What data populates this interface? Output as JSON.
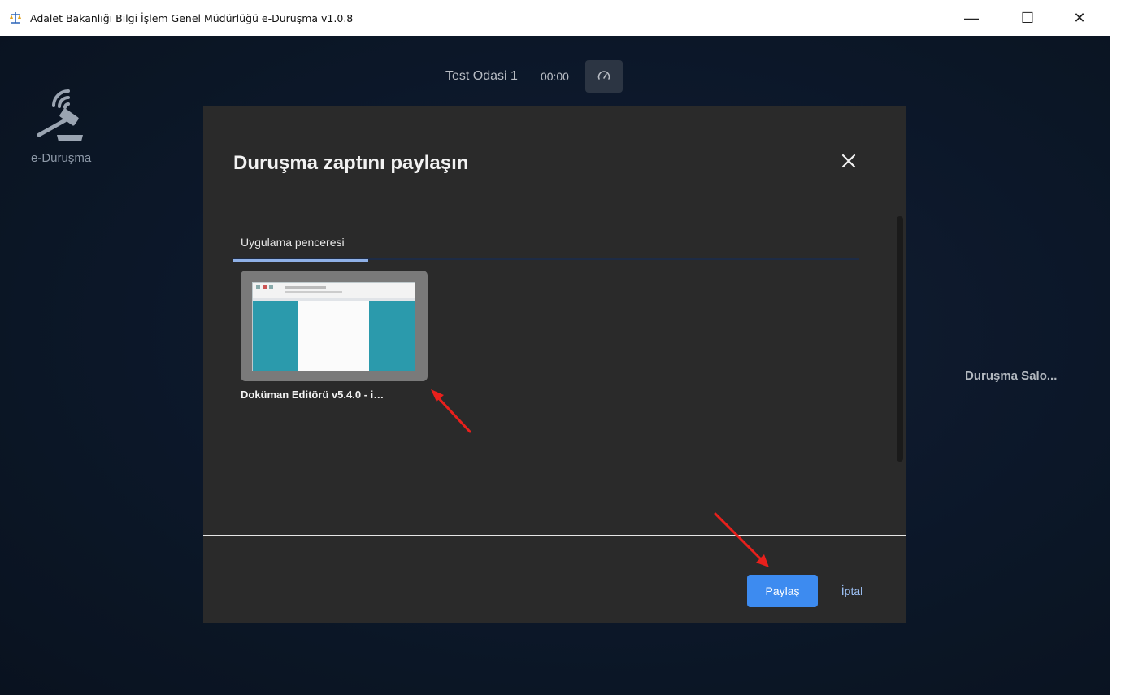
{
  "window": {
    "title": "Adalet Bakanlığı Bilgi İşlem Genel Müdürlüğü e-Duruşma v1.0.8",
    "controls": {
      "minimize": "—",
      "maximize": "☐",
      "close": "✕"
    }
  },
  "app": {
    "logo_label": "e-Duruşma",
    "room_name": "Test Odasi 1",
    "timer": "00:00",
    "side_label": "Duruşma Salo..."
  },
  "dialog": {
    "title": "Duruşma zaptını paylaşın",
    "tabs": [
      {
        "label": "Uygulama penceresi",
        "selected": true
      }
    ],
    "sources": [
      {
        "title": "Doküman Editörü v5.4.0 - i…"
      }
    ],
    "share_label": "Paylaş",
    "cancel_label": "İptal"
  },
  "colors": {
    "accent": "#3d8bf0",
    "dialog_bg": "#2a2a2a",
    "app_bg": "#0e1a2d",
    "annotation_arrow": "#e8201c"
  },
  "icons": {
    "app": "scales-of-justice-icon",
    "logo": "gavel-signal-icon",
    "speed": "speedometer-icon",
    "close": "close-icon"
  }
}
